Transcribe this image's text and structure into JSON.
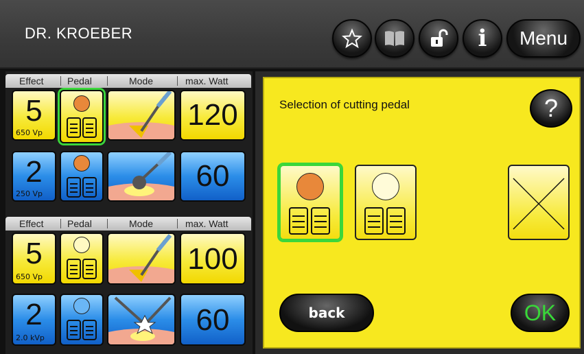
{
  "header": {
    "title": "DR. KROEBER",
    "menu_label": "Menu"
  },
  "toolbar_icons": [
    "star-icon",
    "book-icon",
    "unlock-icon",
    "info-icon"
  ],
  "columns": [
    "Effect",
    "Pedal",
    "Mode",
    "max. Watt"
  ],
  "channels": [
    {
      "effect": "5",
      "voltage": "650 Vp",
      "watt": "120",
      "pedal": "filled",
      "mode": "cut-blade",
      "selected": true
    },
    {
      "effect": "2",
      "voltage": "250 Vp",
      "watt": "60",
      "pedal": "filled",
      "mode": "ball-electrode"
    },
    {
      "effect": "5",
      "voltage": "650 Vp",
      "watt": "100",
      "pedal": "empty",
      "mode": "cut-blade"
    },
    {
      "effect": "2",
      "voltage": "2.0 kVp",
      "watt": "60",
      "pedal": "empty",
      "mode": "bipolar-forceps"
    }
  ],
  "dialog": {
    "title": "Selection of cutting pedal",
    "help_label": "?",
    "back_label": "back",
    "ok_label": "OK"
  },
  "colors": {
    "yellow": "#f7e81f",
    "blue": "#2b8de8",
    "selected": "#3bd63b",
    "pedal_orange": "#e8883a"
  }
}
